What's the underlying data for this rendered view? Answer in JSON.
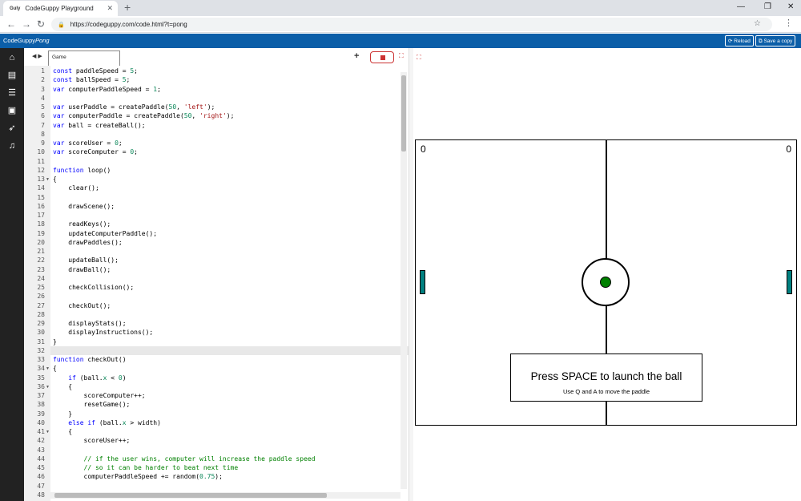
{
  "browser": {
    "tab_title": "CodeGuppy Playground",
    "favicon_text": "Guly",
    "url": "https://codeguppy.com/code.html?t=pong"
  },
  "appbar": {
    "brand": "CodeGuppy",
    "project": "Pong",
    "reload_label": "Reload",
    "save_label": "Save a copy"
  },
  "editor": {
    "tab_label": "Game",
    "lines": [
      "const paddleSpeed = 5;",
      "const ballSpeed = 5;",
      "var computerPaddleSpeed = 1;",
      "",
      "var userPaddle = createPaddle(50, 'left');",
      "var computerPaddle = createPaddle(50, 'right');",
      "var ball = createBall();",
      "",
      "var scoreUser = 0;",
      "var scoreComputer = 0;",
      "",
      "function loop()",
      "{",
      "    clear();",
      "",
      "    drawScene();",
      "",
      "    readKeys();",
      "    updateComputerPaddle();",
      "    drawPaddles();",
      "",
      "    updateBall();",
      "    drawBall();",
      "",
      "    checkCollision();",
      "",
      "    checkOut();",
      "",
      "    displayStats();",
      "    displayInstructions();",
      "}",
      "",
      "function checkOut()",
      "{",
      "    if (ball.x < 0)",
      "    {",
      "        scoreComputer++;",
      "        resetGame();",
      "    }",
      "    else if (ball.x > width)",
      "    {",
      "        scoreUser++;",
      "",
      "        // if the user wins, computer will increase the paddle speed",
      "        // so it can be harder to beat next time",
      "        computerPaddleSpeed += random(0.75);",
      "",
      ""
    ],
    "fold_lines": [
      13,
      34,
      36,
      41
    ],
    "active_line": 32
  },
  "game": {
    "score_left": "0",
    "score_right": "0",
    "message": "Press SPACE to launch the ball",
    "instructions": "Use Q and A to move the paddle",
    "ball_color": "#008000",
    "paddle_color": "#008080"
  }
}
